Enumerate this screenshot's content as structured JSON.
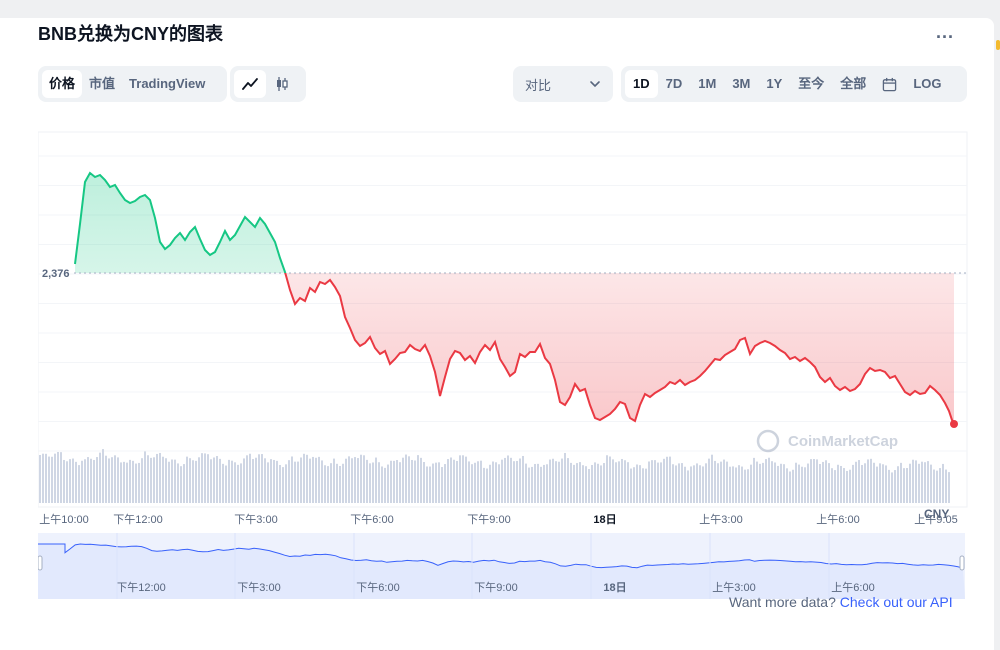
{
  "title": "BNB兑换为CNY的图表",
  "more_label": "...",
  "chart_type_tabs": [
    {
      "label": "价格",
      "active": true
    },
    {
      "label": "市值",
      "active": false
    },
    {
      "label": "TradingView",
      "active": false
    }
  ],
  "chart_mode_tabs": [
    {
      "icon": "line-chart-icon",
      "active": true
    },
    {
      "icon": "candlestick-icon",
      "active": false
    }
  ],
  "compare": {
    "label": "对比",
    "icon": "chevron-down-icon"
  },
  "range_tabs": [
    {
      "label": "1D",
      "active": true
    },
    {
      "label": "7D",
      "active": false
    },
    {
      "label": "1M",
      "active": false
    },
    {
      "label": "3M",
      "active": false
    },
    {
      "label": "1Y",
      "active": false
    },
    {
      "label": "至今",
      "active": false
    },
    {
      "label": "全部",
      "active": false
    },
    {
      "icon": "calendar-icon",
      "active": false
    },
    {
      "label": "LOG",
      "active": false
    }
  ],
  "colors": {
    "up": "#16c784",
    "down": "#ea3943",
    "volume": "#cfd6e4",
    "navigator_line": "#3861fb",
    "navigator_fill": "#e6ecfe",
    "link": "#3861fb"
  },
  "chart_data": {
    "type": "line",
    "baseline_label": "2,376",
    "currency_label": "CNY",
    "watermark": "CoinMarketCap",
    "x_ticks": [
      "上午10:00",
      "下午12:00",
      "下午3:00",
      "下午6:00",
      "下午9:00",
      "18日",
      "上午3:00",
      "上午6:00",
      "上午9:05"
    ],
    "navigator_ticks": [
      "下午12:00",
      "下午3:00",
      "下午6:00",
      "下午9:00",
      "18日",
      "上午3:00",
      "上午6:00"
    ]
  },
  "footer": {
    "text": "Want more data?",
    "link": "Check out our API"
  }
}
